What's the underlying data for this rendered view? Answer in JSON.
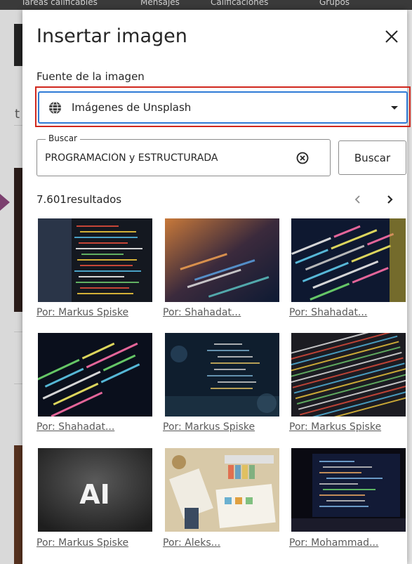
{
  "background": {
    "topbar_items": [
      "Tareas calificables",
      "Mensajes",
      "Calificaciones",
      "Grupos"
    ],
    "left_letter": "t"
  },
  "dialog": {
    "title": "Insertar imagen",
    "close_icon": "close-icon",
    "source": {
      "label": "Fuente de la imagen",
      "selected": "Imágenes de Unsplash",
      "icon": "globe-icon",
      "highlight_color": "#d0271d",
      "focus_color": "#2f7bd6"
    },
    "search": {
      "legend": "Buscar",
      "value": "PROGRAMACIÓN y ESTRUCTURADA",
      "clear_icon": "clear-circle-icon",
      "button_label": "Buscar"
    },
    "results": {
      "count_text": "7.601resultados",
      "prev_icon": "chevron-left-icon",
      "next_icon": "chevron-right-icon"
    },
    "images": [
      {
        "credit": "Por: Markus Spiske",
        "theme": "colorful-code-closeup"
      },
      {
        "credit": "Por: Shahadat...",
        "theme": "code-bokeh-screen"
      },
      {
        "credit": "Por: Shahadat...",
        "theme": "dark-code-editor"
      },
      {
        "credit": "Por: Shahadat...",
        "theme": "diagonal-code-lines"
      },
      {
        "credit": "Por: Markus Spiske",
        "theme": "monitor-code-bokeh"
      },
      {
        "credit": "Por: Markus Spiske",
        "theme": "colorful-code-pattern"
      },
      {
        "credit": "Por: Markus Spiske",
        "theme": "ai-text-dark"
      },
      {
        "credit": "Por: Aleks...",
        "theme": "desk-workspace"
      },
      {
        "credit": "Por: Mohammad...",
        "theme": "laptop-code-dark"
      }
    ],
    "ai_text": "AI"
  }
}
